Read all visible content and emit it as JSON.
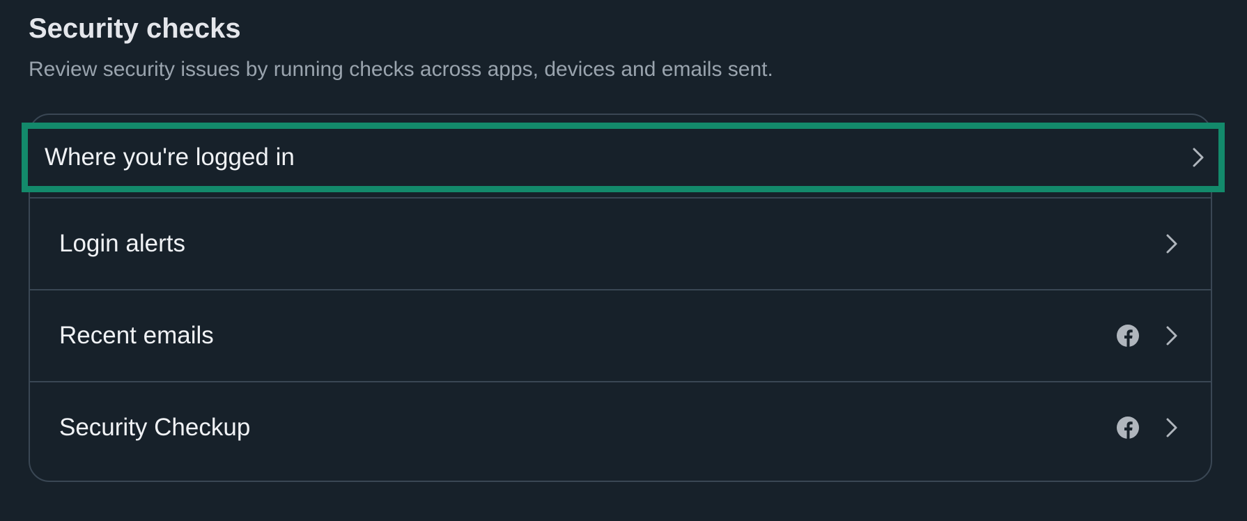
{
  "section": {
    "title": "Security checks",
    "subtitle": "Review security issues by running checks across apps, devices and emails sent."
  },
  "items": [
    {
      "label": "Where you're logged in",
      "icons": [
        "chevron-right-icon"
      ],
      "highlighted": true
    },
    {
      "label": "Login alerts",
      "icons": [
        "chevron-right-icon"
      ]
    },
    {
      "label": "Recent emails",
      "icons": [
        "facebook-icon",
        "chevron-right-icon"
      ]
    },
    {
      "label": "Security Checkup",
      "icons": [
        "facebook-icon",
        "chevron-right-icon"
      ]
    }
  ],
  "colors": {
    "background": "#17212a",
    "border": "#3a4754",
    "highlight": "#138a6b",
    "text": "#f0f2f5",
    "subtext": "#9aa4ae",
    "icon": "#b0b6bd"
  }
}
